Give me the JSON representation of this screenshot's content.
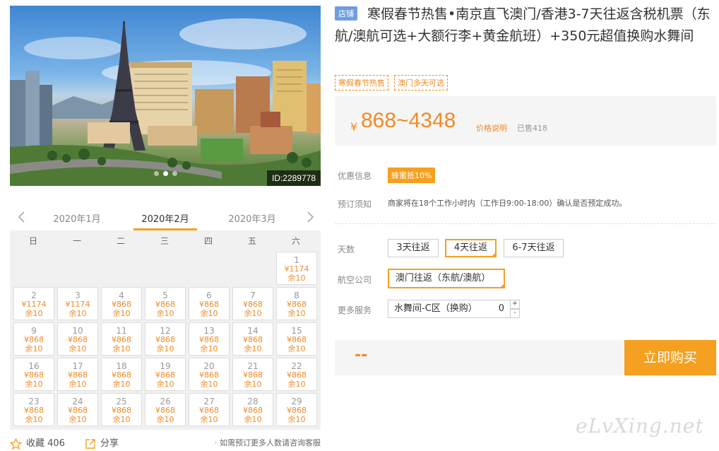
{
  "hero": {
    "id_label": "ID:2289778",
    "slide_count": 3,
    "active_slide": 1
  },
  "calendar": {
    "months": [
      "2020年1月",
      "2020年2月",
      "2020年3月"
    ],
    "active_month": 1,
    "weekdays": [
      "日",
      "一",
      "二",
      "三",
      "四",
      "五",
      "六"
    ],
    "days": [
      {
        "day": "1",
        "price": "¥1174",
        "stock": "余10"
      },
      {
        "day": "2",
        "price": "¥1174",
        "stock": "余10"
      },
      {
        "day": "3",
        "price": "¥1174",
        "stock": "余10"
      },
      {
        "day": "4",
        "price": "¥868",
        "stock": "余10"
      },
      {
        "day": "5",
        "price": "¥868",
        "stock": "余10"
      },
      {
        "day": "6",
        "price": "¥868",
        "stock": "余10"
      },
      {
        "day": "7",
        "price": "¥868",
        "stock": "余10"
      },
      {
        "day": "8",
        "price": "¥868",
        "stock": "余10"
      },
      {
        "day": "9",
        "price": "¥868",
        "stock": "余10"
      },
      {
        "day": "10",
        "price": "¥868",
        "stock": "余10"
      },
      {
        "day": "11",
        "price": "¥868",
        "stock": "余10"
      },
      {
        "day": "12",
        "price": "¥868",
        "stock": "余10"
      },
      {
        "day": "13",
        "price": "¥868",
        "stock": "余10"
      },
      {
        "day": "14",
        "price": "¥868",
        "stock": "余10"
      },
      {
        "day": "15",
        "price": "¥868",
        "stock": "余10"
      },
      {
        "day": "16",
        "price": "¥868",
        "stock": "余10"
      },
      {
        "day": "17",
        "price": "¥868",
        "stock": "余10"
      },
      {
        "day": "18",
        "price": "¥868",
        "stock": "余10"
      },
      {
        "day": "19",
        "price": "¥868",
        "stock": "余10"
      },
      {
        "day": "20",
        "price": "¥868",
        "stock": "余10"
      },
      {
        "day": "21",
        "price": "¥868",
        "stock": "余10"
      },
      {
        "day": "22",
        "price": "¥868",
        "stock": "余10"
      },
      {
        "day": "23",
        "price": "¥868",
        "stock": "余10"
      },
      {
        "day": "24",
        "price": "¥868",
        "stock": "余10"
      },
      {
        "day": "25",
        "price": "¥868",
        "stock": "余10"
      },
      {
        "day": "26",
        "price": "¥868",
        "stock": "余10"
      },
      {
        "day": "27",
        "price": "¥868",
        "stock": "余10"
      },
      {
        "day": "28",
        "price": "¥868",
        "stock": "余10"
      },
      {
        "day": "29",
        "price": "¥868",
        "stock": "余10"
      }
    ]
  },
  "footer": {
    "favorite_label": "收藏 406",
    "share_label": "分享",
    "consult_text": "· 如需预订更多人数请咨询客服"
  },
  "product": {
    "store_badge": "店铺",
    "title": "寒假春节热售•南京直飞澳门/香港3-7天往返含税机票（东航/澳航可选+大额行李+黄金航班）+350元超值换购水舞间",
    "tags": [
      "寒假春节热售",
      "澳门多天可选"
    ],
    "yen": "¥",
    "price_range": "868~4348",
    "price_explain": "价格说明",
    "sold": "已售418"
  },
  "info": {
    "promo_label": "优惠信息",
    "promo_badge": "蜂蜜抵10%",
    "notice_label": "预订须知",
    "notice_text": "商家将在18个工作小时内（工作日9:00-18:00）确认是否预定成功。"
  },
  "options": {
    "days_label": "天数",
    "days": [
      "3天往返",
      "4天往返",
      "6-7天往返"
    ],
    "days_selected": 1,
    "airline_label": "航空公司",
    "airline": "澳门往返（东航/澳航）",
    "service_label": "更多服务",
    "service_name": "水舞间-C区（换购）",
    "service_qty": "0",
    "plus": "+",
    "minus": "-"
  },
  "buy": {
    "total": "--",
    "button_label": "立即购买"
  },
  "watermark": "eLvXing.net",
  "colors": {
    "accent": "#f5a020",
    "price": "#f08a24",
    "store_badge": "#6d9ee0"
  }
}
